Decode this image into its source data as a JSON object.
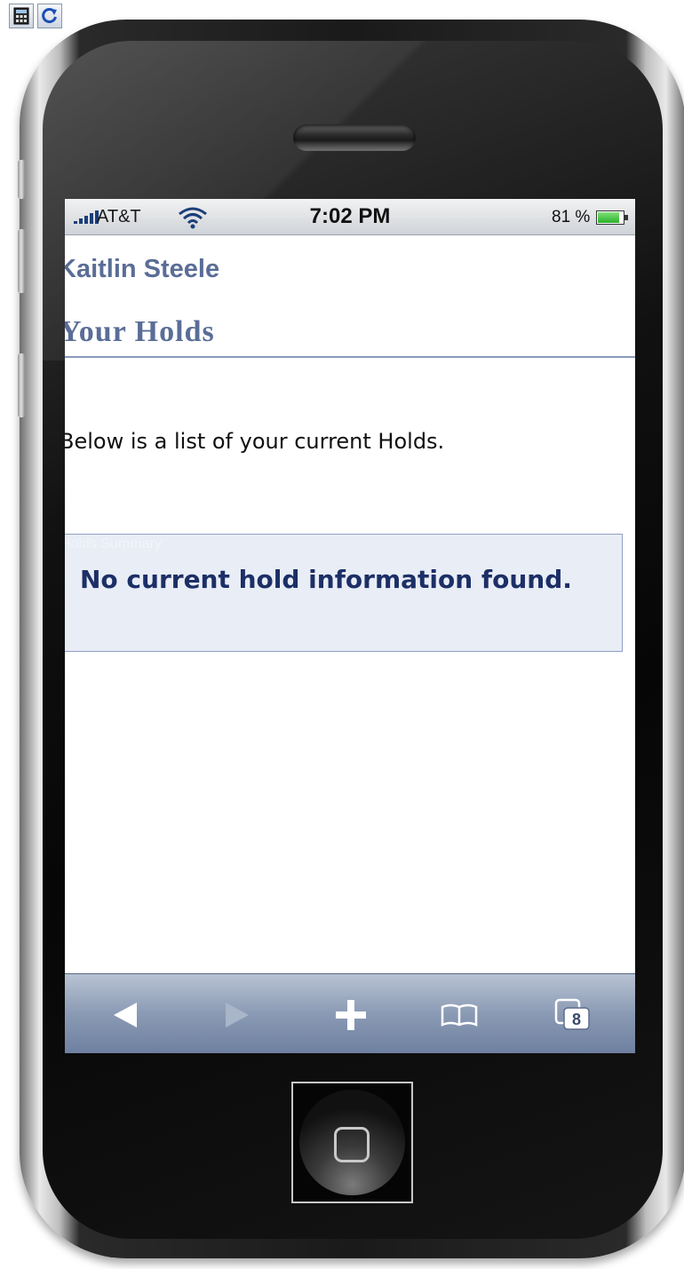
{
  "toolbar_icons": {
    "left": "calculator-icon",
    "right": "refresh-icon"
  },
  "status_bar": {
    "carrier": "AT&T",
    "time": "7:02 PM",
    "battery_percent": "81 %",
    "battery_level": 0.81
  },
  "page": {
    "user_name": "Kaitlin Steele",
    "title": "Your Holds",
    "intro": "Below is a list of your current Holds.",
    "holds_caption": "Holds Summary",
    "holds_message": "No current hold information found."
  },
  "safari_toolbar": {
    "back_icon": "back-arrow-icon",
    "forward_icon": "forward-arrow-icon",
    "add_icon": "plus-icon",
    "bookmarks_icon": "book-icon",
    "pages_icon": "pages-icon",
    "pages_count": "8"
  },
  "colors": {
    "heading": "#5a6d97",
    "holds_text": "#1c2f66",
    "holds_box_bg": "#e9edf6",
    "toolbar": "#8a9ab4"
  }
}
